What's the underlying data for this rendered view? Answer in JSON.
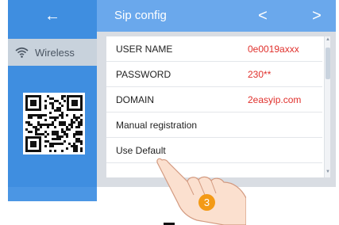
{
  "header": {
    "title": "Sip config",
    "back_icon": "←",
    "prev_icon": "<",
    "next_icon": ">"
  },
  "sidebar": {
    "items": [
      {
        "label": "Wireless",
        "icon": "wifi-icon"
      }
    ]
  },
  "sip_fields": [
    {
      "label": "USER NAME",
      "value": "0e0019axxx"
    },
    {
      "label": "PASSWORD",
      "value": "230**"
    },
    {
      "label": "DOMAIN",
      "value": "2easyip.com"
    },
    {
      "label": "Manual registration",
      "value": ""
    },
    {
      "label": "Use Default",
      "value": ""
    }
  ],
  "step_badge": "3",
  "colors": {
    "sidebar": "#3f8ee0",
    "header": "#6aa8ec",
    "value_text": "#e0302c",
    "badge": "#f39a16"
  }
}
